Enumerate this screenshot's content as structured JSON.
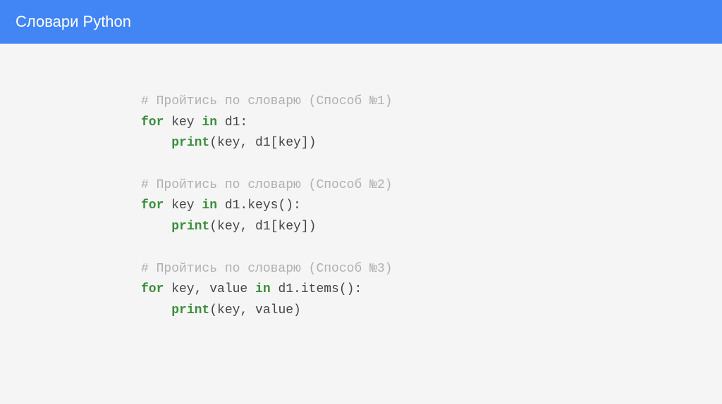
{
  "header": {
    "title": "Словари Python"
  },
  "code": {
    "blocks": [
      {
        "comment": "# Пройтись по словарю (Способ №1)",
        "line1_for": "for",
        "line1_var": " key ",
        "line1_in": "in",
        "line1_rest": " d1:",
        "line2_indent": "    ",
        "line2_print": "print",
        "line2_args": "(key, d1[key])"
      },
      {
        "comment": "# Пройтись по словарю (Способ №2)",
        "line1_for": "for",
        "line1_var": " key ",
        "line1_in": "in",
        "line1_rest": " d1.keys():",
        "line2_indent": "    ",
        "line2_print": "print",
        "line2_args": "(key, d1[key])"
      },
      {
        "comment": "# Пройтись по словарю (Способ №3)",
        "line1_for": "for",
        "line1_var": " key, value ",
        "line1_in": "in",
        "line1_rest": " d1.items():",
        "line2_indent": "    ",
        "line2_print": "print",
        "line2_args": "(key, value)"
      }
    ]
  }
}
